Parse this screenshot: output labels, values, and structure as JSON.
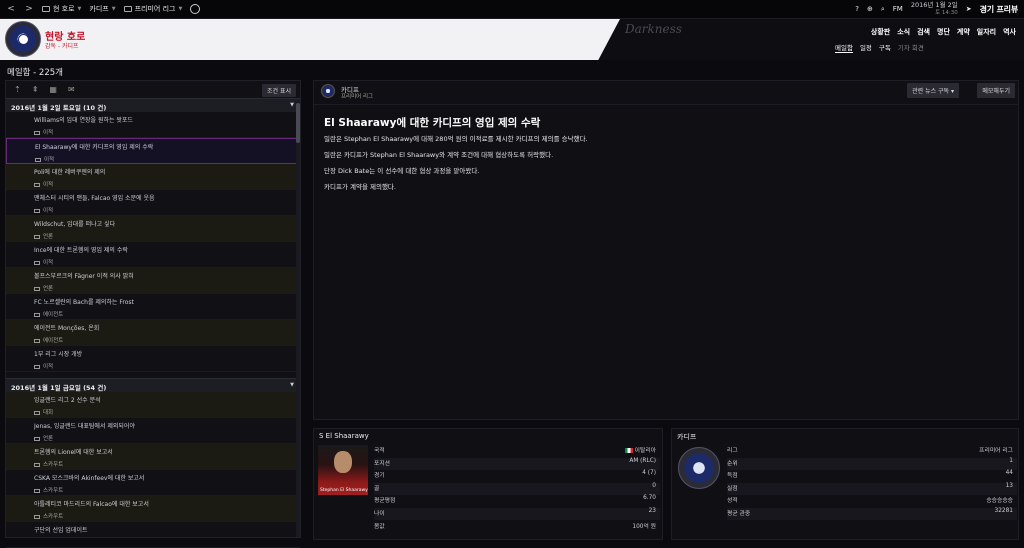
{
  "topbar": {
    "home": "현 호로",
    "club": "카디프",
    "league": "프리미어 리그",
    "date_line1": "2016년 1월 2일",
    "date_line2": "토 14:30",
    "fm": "FM",
    "continue": "경기 프리뷰"
  },
  "club_header": {
    "name": "현랑 호로",
    "sub": "감독 - 카디프",
    "skin": "Darkness",
    "nav": [
      "상황판",
      "소식",
      "검색",
      "명단",
      "계약",
      "일자리",
      "역사"
    ],
    "subnav": [
      "메일함",
      "일정",
      "구독",
      "기자 회견"
    ]
  },
  "page_title": "메일함 - 225개",
  "inbox": {
    "filter_label": "조건 표시",
    "day1": "2016년 1월 2일 토요일 (10 건)",
    "day2": "2016년 1월 1일 금요일 (54 건)",
    "items1": [
      {
        "title": "Williams의 임대 연장을 원하는 왓포드",
        "tag": "이적"
      },
      {
        "title": "El Shaarawy에 대한 카디프의 영입 제의 수락",
        "tag": "이적"
      },
      {
        "title": "Poli에 대한 레버쿠젠의 제의",
        "tag": "이적"
      },
      {
        "title": "맨체스터 시티의 맨들, Falcao 영입 소문에 웃음",
        "tag": "이적"
      },
      {
        "title": "Wildschut, 임대를 떠나고 싶다",
        "tag": "언론"
      },
      {
        "title": "Ince에 대한 트론헴의 영입 제의 수락",
        "tag": "이적"
      },
      {
        "title": "볼프스부르크의 Fägner 이적 의사 밝혀",
        "tag": "언론"
      },
      {
        "title": "FC 노르셸란의 Bach를 제의하는 Frost",
        "tag": "에이전트"
      },
      {
        "title": "에이전트 Monções, 온회",
        "tag": "에이전트"
      },
      {
        "title": "1부 리그 시장 개방",
        "tag": "이적"
      }
    ],
    "items2": [
      {
        "title": "잉글랜드 리그 2 선수 분석",
        "tag": "대회"
      },
      {
        "title": "Jenas, 잉글랜드 대표팀에서 제외되어야",
        "tag": "언론"
      },
      {
        "title": "트론헴의 Lionel에 대한 보고서",
        "tag": "스카우트"
      },
      {
        "title": "CSKA 모스크바의 Akinfeev에 대한 보고서",
        "tag": "스카우트"
      },
      {
        "title": "아틀레티코 마드리드의 Falcao에 대한 보고서",
        "tag": "스카우트"
      },
      {
        "title": "구단의 선임 업데이트",
        "tag": ""
      }
    ]
  },
  "article": {
    "club": "카디프",
    "league": "프리미어 리그",
    "btn_related": "관련 뉴스 구독 ▾",
    "btn_memo": "메모해두기",
    "title": "El Shaarawy에 대한 카디프의 영입 제의 수락",
    "paragraphs": [
      "밀란은 Stephan El Shaarawy에 대해 280억 원의 이적료를 제시한 카디프의 제의를 승낙했다.",
      "밀란은 카디프가 Stephan El Shaarawy와 계약 조건에 대해 협상하도록 허락했다.",
      "단장 Dick Bate는 이 선수에 대한 협상 과정을 맡아왔다.",
      "카디프가 계약을 제의했다."
    ]
  },
  "player_card": {
    "title": "S El Shaarawy",
    "photo_caption": "Stephan El Shaarawy",
    "rows": [
      {
        "k": "국적",
        "v": "이탈리아"
      },
      {
        "k": "포지션",
        "v": "AM (RLC)"
      },
      {
        "k": "경기",
        "v": "4 (7)"
      },
      {
        "k": "골",
        "v": "0"
      },
      {
        "k": "평균평점",
        "v": "6.70"
      },
      {
        "k": "나이",
        "v": "23"
      },
      {
        "k": "몸값",
        "v": "100억 원"
      }
    ]
  },
  "club_card": {
    "title": "카디프",
    "rows": [
      {
        "k": "리그",
        "v": "프리미어 리그"
      },
      {
        "k": "순위",
        "v": "1"
      },
      {
        "k": "득점",
        "v": "44"
      },
      {
        "k": "실점",
        "v": "13"
      },
      {
        "k": "성적",
        "v": "승승승승승"
      },
      {
        "k": "평균 관중",
        "v": "32281"
      }
    ]
  },
  "colors": {
    "accent": "#c8152a",
    "selected_border": "#6a2a7a"
  }
}
